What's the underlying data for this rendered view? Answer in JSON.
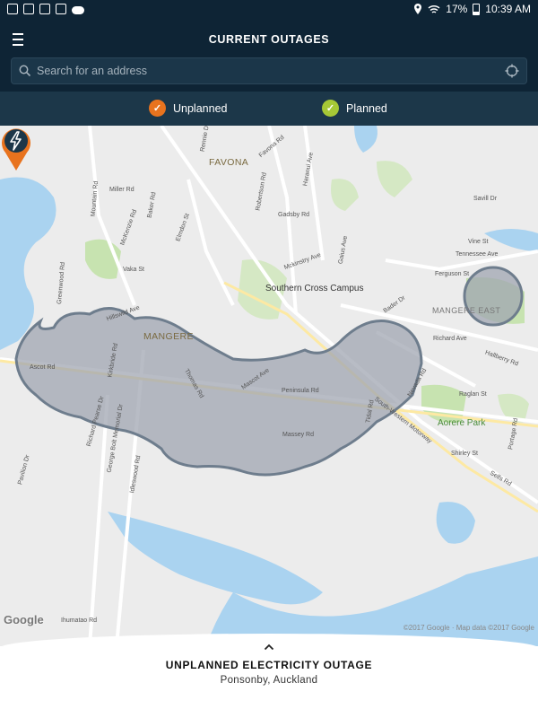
{
  "status_bar": {
    "battery": "17%",
    "time": "10:39 AM"
  },
  "header": {
    "title": "CURRENT OUTAGES",
    "menu_icon": "hamburger-menu-icon"
  },
  "search": {
    "placeholder": "Search for an address",
    "icon": "search-icon",
    "locate_icon": "crosshair-location-icon"
  },
  "legend": {
    "unplanned": {
      "label": "Unplanned",
      "color": "#e8731e"
    },
    "planned": {
      "label": "Planned",
      "color": "#a6c836"
    }
  },
  "map": {
    "suburbs": {
      "favona": "FAVONA",
      "mangere": "MANGERE",
      "mangere_east": "MANGERE EAST"
    },
    "pois": {
      "campus": "Southern Cross Campus",
      "park": "Aorere Park"
    },
    "streets": {
      "rennie": "Rennie Dr",
      "favona": "Favona Rd",
      "haranui": "Haranui Ave",
      "miller": "Miller Rd",
      "mountain": "Mountain Rd",
      "mckenzie": "McKenzie Rd",
      "baker": "Baker Rd",
      "robertson": "Robertson Rd",
      "gadsby": "Gadsby Rd",
      "savill": "Savill Dr",
      "elmdon": "Elmdon St",
      "vine": "Vine St",
      "tennessee": "Tennessee Ave",
      "vakas": "Vaka St",
      "mckinstry": "Mckinstry Ave",
      "gaius": "Gaius Ave",
      "ferguson": "Ferguson St",
      "greenwood": "Greenwood Rd",
      "hillswild": "Hillswild Ave",
      "bader": "Bader Dr",
      "richard": "Richard Ave",
      "hallberry": "Hallberry Rd",
      "ascot": "Ascot Rd",
      "kirkbride": "Kirkbride Rd",
      "thomas": "Thomas Rd",
      "mascot": "Mascot Ave",
      "peninsula": "Peninsula Rd",
      "nevada": "Nevada Rd",
      "raglan": "Raglan St",
      "tidal": "Tidal Rd",
      "motorway": "South-Western Motorway",
      "portage": "Portage Rd",
      "massey": "Massey Rd",
      "richard_pearse": "Richard Pearse Dr",
      "gbm": "George Bolt Memorial Dr",
      "idleswood": "Idleswood Rd",
      "shirley": "Shirley St",
      "selfs": "Selfs Rd",
      "pavilion": "Pavilion Dr",
      "ihumatao": "Ihumatao Rd"
    },
    "google": "Google",
    "copyright": "©2017 Google · Map data ©2017 Google"
  },
  "outage": {
    "title": "UNPLANNED ELECTRICITY OUTAGE",
    "location": "Ponsonby, Auckland",
    "pin_icon": "lightning-bolt-icon",
    "expand_icon": "chevron-up-icon"
  }
}
